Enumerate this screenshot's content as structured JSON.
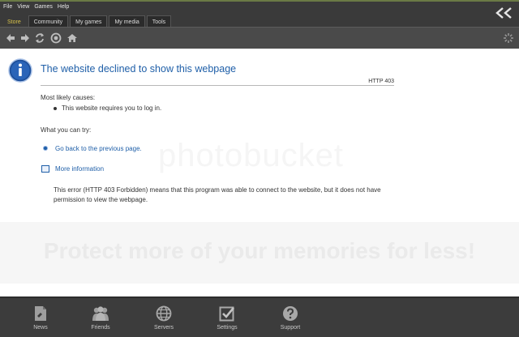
{
  "menu": {
    "file": "File",
    "view": "View",
    "games": "Games",
    "help": "Help"
  },
  "tabs": [
    "Store",
    "Community",
    "My games",
    "My media",
    "Tools"
  ],
  "page": {
    "title": "The website declined to show this webpage",
    "http_code": "HTTP 403",
    "causes_heading": "Most likely causes:",
    "cause_1": "This website requires you to log in.",
    "try_heading": "What you can try:",
    "go_back": "Go back to the previous page.",
    "more_info": "More information",
    "description": "This error (HTTP 403 Forbidden) means that this program was able to connect to the website, but it does not have permission to view the webpage."
  },
  "watermark": {
    "logo": "photobucket",
    "tagline": "Protect more of your memories for less!"
  },
  "bottom_nav": {
    "news": "News",
    "friends": "Friends",
    "servers": "Servers",
    "settings": "Settings",
    "support": "Support"
  },
  "colors": {
    "accent_link": "#1f5fa8",
    "active_tab": "#d7c14a"
  }
}
